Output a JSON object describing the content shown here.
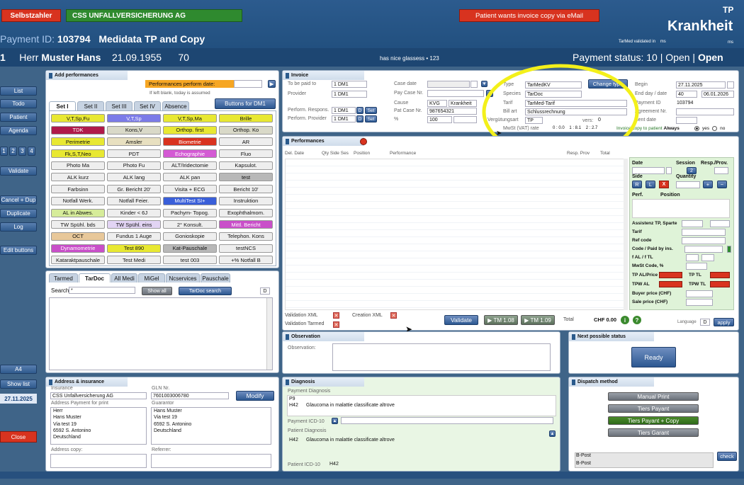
{
  "header": {
    "selbstzahler": "Selbstzahler",
    "insurer": "CSS UNFALLVERSICHERUNG AG",
    "email_alert": "Patient wants invoice copy via eMail",
    "tp": "TP",
    "krankheit": "Krankheit",
    "payment_id_label": "Payment ID:",
    "payment_id": "103794",
    "payment_title": "Medidata TP and Copy",
    "tarmed_note": "TarMed validated in",
    "tarmed_ms": "ms",
    "ms2": "ms"
  },
  "patient": {
    "num": "1",
    "salutation": "Herr",
    "name": "Muster Hans",
    "dob": "21.09.1955",
    "age": "70",
    "note": "has nice glassess • 123",
    "status_label": "Payment status: 10 |",
    "status_open": "Open |",
    "status_open2": "Open"
  },
  "nav": {
    "list": "List",
    "todo": "Todo",
    "patient": "Patient",
    "agenda": "Agenda",
    "n1": "1",
    "n2": "2",
    "n3": "3",
    "n4": "4",
    "validate": "Validate",
    "cancel_dup": "Cancel + Dup",
    "duplicate": "Duplicate",
    "log": "Log",
    "edit_buttons": "Edit buttons",
    "a4": "A4",
    "show_list": "Show list",
    "date": "27.11.2025",
    "close": "Close"
  },
  "add_perf": {
    "title": "Add performances",
    "perform_date_label": "Performances  perform date:",
    "hint": "If left blank, today is assumed",
    "buttons_for": "Buttons for DM1",
    "sets": [
      "Set I",
      "Set II",
      "Set III",
      "Set IV",
      "Absence"
    ],
    "rows": [
      [
        [
          "V,T,Sp,Fu",
          "#e8e832"
        ],
        [
          "V,T,Sp",
          "#7b7be8"
        ],
        [
          "V,T,Sp,Ma",
          "#e8e832"
        ],
        [
          "Brille",
          "#e8e832"
        ]
      ],
      [
        [
          "TDK",
          "#b01a4a"
        ],
        [
          "Kons,V",
          "#d9d9c8"
        ],
        [
          "Orthop. first",
          "#e8e832"
        ],
        [
          "Orthop. Ko",
          "#d9d9c8"
        ]
      ],
      [
        [
          "Perimetrie",
          "#e8e832"
        ],
        [
          "Amsler",
          "#e8e0c0"
        ],
        [
          "Biometrie",
          "#d9331f"
        ],
        [
          "AR",
          "#eeeeee"
        ]
      ],
      [
        [
          "Fk,S,T,Neo",
          "#e8e832"
        ],
        [
          "PDT",
          "#eeeeee"
        ],
        [
          "Echographie",
          "#d45ad4"
        ],
        [
          "Fluo",
          "#eeeeee"
        ]
      ],
      [
        [
          "Photo Ma",
          "#eeeeee"
        ],
        [
          "Photo Fu",
          "#eeeeee"
        ],
        [
          "ALT/Iridectomie",
          "#eeeeee"
        ],
        [
          "Kapsulot.",
          "#eeeeee"
        ]
      ],
      [
        [
          "ALK kurz",
          "#eeeeee"
        ],
        [
          "ALK lang",
          "#eeeeee"
        ],
        [
          "ALK pan",
          "#eeeeee"
        ],
        [
          "test",
          "#b8b8b8"
        ]
      ],
      [
        [
          "Farbsinn",
          "#eeeeee"
        ],
        [
          "Gr. Bericht 20'",
          "#eeeeee"
        ],
        [
          "Visita + ECG",
          "#eeeeee"
        ],
        [
          "Bericht 10'",
          "#eeeeee"
        ]
      ],
      [
        [
          "Notfall Werk.",
          "#eeeeee"
        ],
        [
          "Notfall Feier.",
          "#eeeeee"
        ],
        [
          "MultiTest SI+",
          "#3a5fd9"
        ],
        [
          "Instruktion",
          "#eeeeee"
        ]
      ],
      [
        [
          "AL in Abwes.",
          "#d6ec9a"
        ],
        [
          "Kinder < 6J",
          "#eeeeee"
        ],
        [
          "Pachym- Topog.",
          "#eeeeee"
        ],
        [
          "Exophthalmom.",
          "#eeeeee"
        ]
      ],
      [
        [
          "TW Spühl. bds",
          "#eeeeee"
        ],
        [
          "TW Spühl. eins",
          "#e2d4f4"
        ],
        [
          "2° Konsult.",
          "#eeeeee"
        ],
        [
          "Mittl. Bericht",
          "#c94fc9"
        ]
      ],
      [
        [
          "OCT",
          "#e8c89a"
        ],
        [
          "Fundus 1 Auge",
          "#eeeeee"
        ],
        [
          "Gonioskopie",
          "#eeeeee"
        ],
        [
          "Telephon. Kons",
          "#eeeeee"
        ]
      ],
      [
        [
          "Dynamometrie",
          "#c94fc9"
        ],
        [
          "Test 890",
          "#e8e832"
        ],
        [
          "Kat-Pauschale",
          "#b8b8b8"
        ],
        [
          "testNCS",
          "#eeeeee"
        ]
      ],
      [
        [
          "Kataraktpauschale",
          "#eeeeee"
        ],
        [
          "Test Medi",
          "#eeeeee"
        ],
        [
          "test 003",
          "#eeeeee"
        ],
        [
          "+% Notfall B",
          "#eeeeee"
        ]
      ]
    ],
    "tabs2": [
      "Tarmed",
      "TarDoc",
      "All Medi",
      "MiGel",
      "Ncservices",
      "Pauschale"
    ],
    "search_label": "Search",
    "search_value": "*",
    "show_all": "Show all",
    "tardoc_search": "TarDoc search",
    "d": "D"
  },
  "invoice": {
    "title": "Invoice",
    "to_be_paid_label": "To be paid to",
    "to_be_paid": "1 DM1",
    "provider_label": "Provider",
    "provider": "1 DM1",
    "resp_label": "Perform. Respons.",
    "resp": "1 DM1",
    "prov2_label": "Perform. Provider",
    "prov2": "1 DM1",
    "d": "D",
    "set": "Set",
    "case_date_label": "Case date",
    "pay_case_label": "Pay Case Nr.",
    "cause_label": "Cause",
    "cause": "KVG",
    "cause2": "Krankheit",
    "pat_case_label": "Pat Case Nr.",
    "pat_case": "987654321",
    "pct_label": "%",
    "pct": "100",
    "type_label": "Type",
    "type": "TarMedKV",
    "change_type": "Change type",
    "species_label": "Species",
    "species": "TarDoc",
    "tarif_label": "Tarif",
    "tarif": "TarMed-Tarif",
    "bill_label": "Bill art",
    "bill": "Schlussrechnung",
    "verg_label": "Vergütungsart",
    "verg": "TP",
    "vers_label": "vers:",
    "vers": "0",
    "mwst_label": "MwSt (VAT) rate",
    "mwst": "0 : 0.0    1 : 8.1    2 : 2.7",
    "begin_label": "Begin",
    "begin": "27.11.2025",
    "end_label": "End day / date",
    "end_days": "40",
    "end_date": "06.01.2026",
    "payment_id_label": "Payment ID",
    "payment_id": "103794",
    "agreement_label": "Agreement Nr.",
    "sent_label": "Sent date",
    "copy_label": "Invoice copy to patient",
    "copy_val": "Always",
    "yes": "yes",
    "no": "no"
  },
  "performances": {
    "title": "Performances",
    "cols": [
      "Del. Date",
      "Qty Side Ses",
      "Position",
      "Performance",
      "Resp. Prov",
      "Total"
    ],
    "date_label": "Date",
    "session_label": "Session",
    "session": "2",
    "resp_prov_label": "Resp./Prov.",
    "side_label": "Side",
    "quantity_label": "Quantity",
    "r": "R",
    "l": "L",
    "x": "X",
    "plus": "+",
    "minus": "−",
    "perf_label": "Perf.",
    "position_label": "Position",
    "assist_label": "Assistenz TP, Sparte",
    "tarif_label": "Tarif",
    "ref_label": "Ref code",
    "code_label": "Code / Paid by ins.",
    "fal_label": "f AL / f TL",
    "mwst_label": "MwSt Code, %",
    "tpal_label": "TP AL/Price",
    "tptl_label": "TP TL",
    "tpwal_label": "TPW AL",
    "tpwtl_label": "TPW TL",
    "buyer_label": "Buyer price (CHF)",
    "sale_label": "Sale price (CHF)",
    "val_xml": "Validation XML",
    "creation_xml": "Creation XML",
    "val_tarmed": "Validation Tarmed",
    "validate": "Validate",
    "tm108": "TM 1.08",
    "tm109": "TM 1.09",
    "total_label": "Total",
    "total": "CHF 0.00",
    "language_label": "Language",
    "language": "D",
    "apply": "apply"
  },
  "observation": {
    "title": "Observation",
    "label": "Observation:"
  },
  "next_status": {
    "title": "Next possible status",
    "ready": "Ready"
  },
  "address": {
    "title": "Address & insurance",
    "insurance_label": "Insurance",
    "insurance": "CSS Unfallversicherung AG",
    "gln_label": "GLN  Nr.",
    "gln": "7601003006780",
    "modify": "Modify",
    "addr_pay_label": "Address Payment for print",
    "addr_lines": [
      "Herr",
      "Hans Muster",
      "Via test 19",
      "6592 S. Antonino",
      "Deutschland"
    ],
    "guarantor_label": "Guarantor",
    "guarantor_lines": [
      "Hans Muster",
      "Via test 19",
      "6592 S. Antonino",
      "Deutschland"
    ],
    "addr_copy_label": "Address copy:",
    "referrer_label": "Referrer:"
  },
  "diagnosis": {
    "title": "Diagnosis",
    "pay_diag_label": "Payment Diagnosis",
    "p9": "P9",
    "h42": "H42",
    "h42_text": "Glaucoma in malattie classificate altrove",
    "icd_label": "Payment ICD-10",
    "pat_diag_label": "Patient Diagnosis",
    "pat_h42": "H42",
    "pat_h42_text": "Glaucoma in malattie classificate altrove",
    "pat_icd_label": "Patient ICD-10",
    "pat_icd": "H42"
  },
  "dispatch": {
    "title": "Dispatch method",
    "manual": "Manual Print",
    "tiers_payant": "Tiers Payant",
    "tiers_copy": "Tiers Payant + Copy",
    "tiers_garant": "Tiers Garant",
    "bpost1": "B-Post",
    "bpost2": "B-Post",
    "check": "check"
  }
}
